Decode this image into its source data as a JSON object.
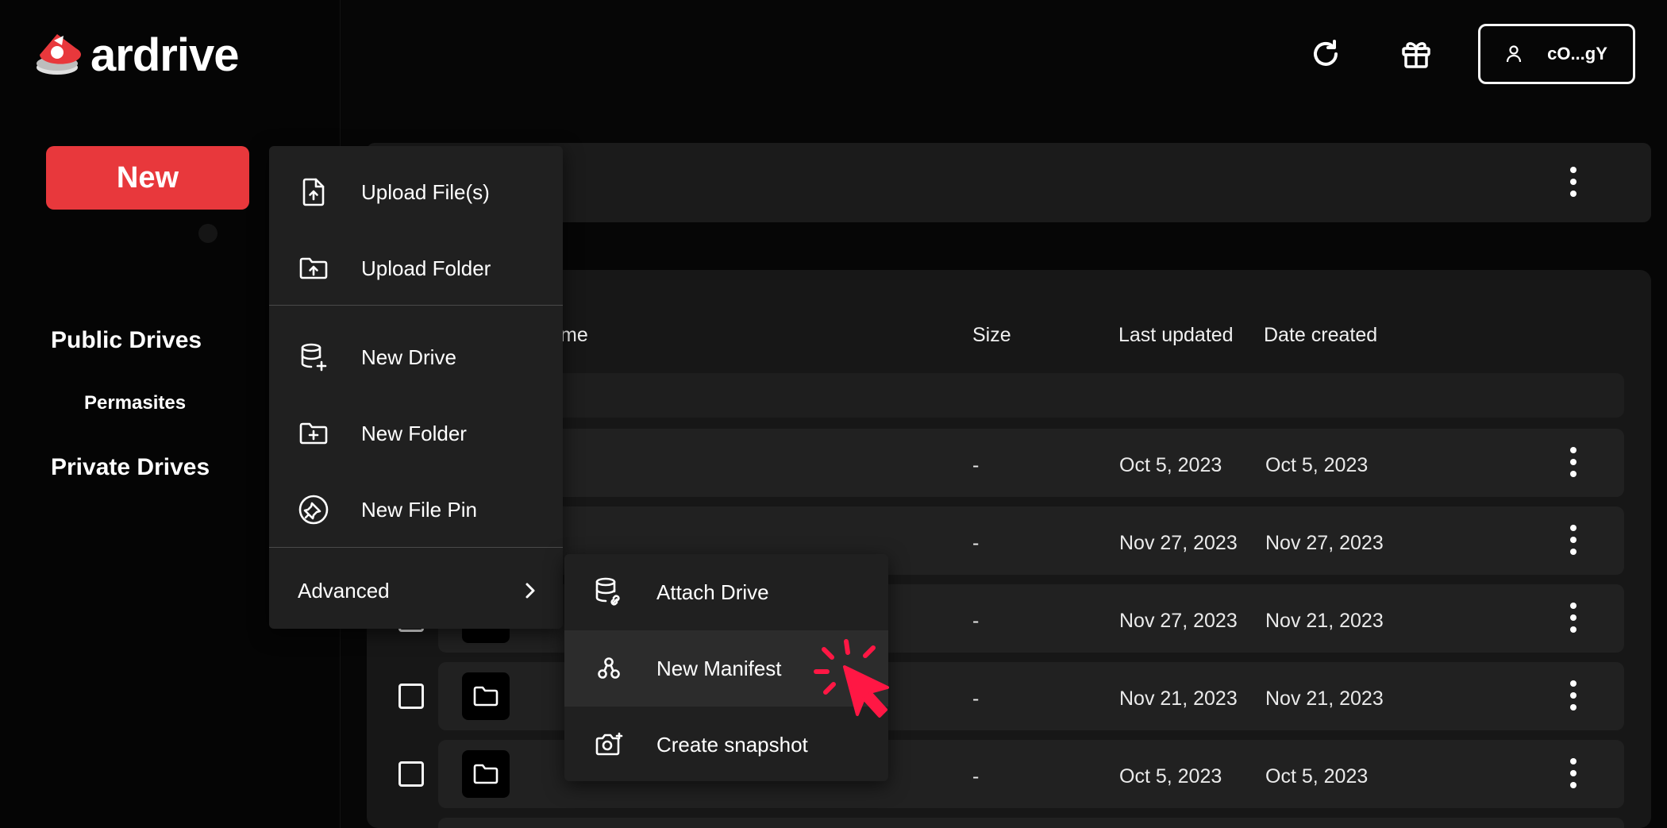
{
  "app": {
    "logo_text": "ardrive"
  },
  "sidebar": {
    "new_button": "New",
    "public_drives": "Public Drives",
    "permasites": "Permasites",
    "private_drives": "Private Drives"
  },
  "header": {
    "profile_label": "cO...gY"
  },
  "table": {
    "headers": {
      "name": "me",
      "size": "Size",
      "last_updated": "Last updated",
      "date_created": "Date created"
    },
    "rows": [
      {
        "size": "-",
        "last_updated": "Oct 5, 2023",
        "date_created": "Oct 5, 2023"
      },
      {
        "size": "-",
        "last_updated": "Nov 27, 2023",
        "date_created": "Nov 27, 2023"
      },
      {
        "size": "-",
        "last_updated": "Nov 27, 2023",
        "date_created": "Nov 21, 2023"
      },
      {
        "size": "-",
        "last_updated": "Nov 21, 2023",
        "date_created": "Nov 21, 2023"
      },
      {
        "size": "-",
        "last_updated": "Oct 5, 2023",
        "date_created": "Oct 5, 2023"
      }
    ]
  },
  "new_menu": {
    "upload_files": "Upload File(s)",
    "upload_folder": "Upload Folder",
    "new_drive": "New Drive",
    "new_folder": "New Folder",
    "new_file_pin": "New File Pin",
    "advanced": "Advanced"
  },
  "advanced_menu": {
    "attach_drive": "Attach Drive",
    "new_manifest": "New Manifest",
    "create_snapshot": "Create snapshot"
  },
  "colors": {
    "brand_red": "#e8383c",
    "cursor_red": "#ff1744",
    "background": "#060606"
  }
}
